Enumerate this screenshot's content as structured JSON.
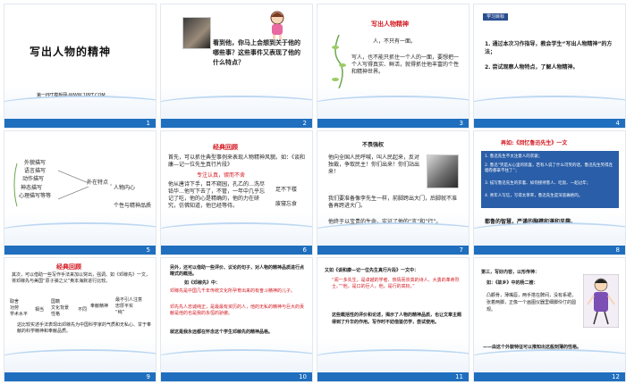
{
  "slides": [
    {
      "number": "1",
      "title": "写出人物的精神",
      "footer": "第一PPT模板网-WWW.1PPT.COM"
    },
    {
      "number": "2",
      "text": "看到他，你马上会想到关于他的哪些事？这些事件又表现了他的什么特点？"
    },
    {
      "number": "3",
      "heading": "写出人物精神",
      "line1": "人，不只有一面。",
      "body": "写人，也不能只抓住一个人的一面，要想把一个人写得真实、鲜活，就得抓住他丰富的个性和精神世界。"
    },
    {
      "number": "4",
      "tag": "学习目标",
      "goal1": "1. 通过本次习作指导，教会学生“写出人物精神”的方法；",
      "goal2": "2. 尝试观察人物特点，了解人物精神。"
    },
    {
      "number": "5",
      "items": [
        "外貌描写",
        "语言描写",
        "动作描写",
        "神态描写",
        "心理描写等等"
      ],
      "outer": "外在特点",
      "inner": "人物内心",
      "personality": "个性与精神品质"
    },
    {
      "number": "6",
      "heading": "经典回顾",
      "intro": "首先，可以抓住典型事例来表现人物精神风貌。如：《谈和康—记一位先生真行片段》",
      "red_label": "专注认真，锲而不舍",
      "body": "他从唐诗下手，目不窥园，孔乙的…洗尽铅华…他写下去了，不管，一年中几乎忘记了吃，他的心是精确的，他的力在研究，仿佛知道，他已经等待。",
      "side1": "足不下楼",
      "side2": "废寝忘食"
    },
    {
      "number": "7",
      "line1": "不畏强权",
      "body": "他向全国人民呼喊，叫人民起来，反对独裁，争取民主！你们出来！你们站出来！",
      "body2": "我们要准备像李先生一样，前脚跨出大门，后脚就不准备再跨进大门。",
      "body3": "他终于以宝贵的生命，实证了他的“言”和“行”。"
    },
    {
      "number": "8",
      "title": "再如:《回忆鲁迅先生》一文",
      "points": [
        "1. 鲁迅先生不太注意人的衣裳；",
        "2. 鲁迅“笑是从心里的欢喜，若有人说了什么可笑的话，鲁迅先生笑得连烟卷都拿不住了”；",
        "3. 描写鲁迅先生的衣着、如何接待客人、吃饭、一起过年；",
        "4. 青年人写信，写得太草率，鲁迅先生是深恶痛绝的。"
      ],
      "footer_line": "都鲁的智慧，严谨的胸襟和谦和风趣。"
    },
    {
      "number": "9",
      "heading": "经典回顾",
      "intro": "其次，可以借助一些写作手法来加以突出，强调。如《邓稼先》一文，将邓稼先与美国“原子弹之父”奥本海默进行比较。",
      "col1": [
        "取舍",
        "功劳",
        "学术水平"
      ],
      "col2": "相当",
      "col3": [
        "国籍",
        "文化背景",
        "性格"
      ],
      "col4": "不同",
      "col5": "奉献精神",
      "col6": [
        "最不引人注意",
        "忠厚平实",
        "“纯”"
      ],
      "body": "这比较实述手法表现出邓稼先为中国科学家的气质和无私心、甘于奉献的科学精神和奉献品质。"
    },
    {
      "number": "10",
      "text1": "另外，还可以借助一些评价、议论的句子，对人物的精神品质进行点睛式的概括。",
      "text2": "如《邓稼先》中：",
      "text3": "邓稼先是中国几千年传统文化所孕育出来的有奋斗精神的儿子。",
      "text4": "邓先先人忠诚纯正，是最最有资历的人，他的无私的精神与巨大的贡献是他的也是我的永恒的骄傲。",
      "text5": "就这是我永远都在怀念这个学生邓稼先的精神品格。"
    },
    {
      "number": "11",
      "text1": "又如《谈和康—记一位先生真行片段》一文中：",
      "quote": "“闻一多先生，是卓越的学者、热情而崇高的诗人、大勇的革命烈士。”“他，是口的巨人，他，是行的高标。”",
      "body": "这些概括性的评价和论述，揭示了人物的精神品质，也让文章主题得到了升华的作用。写作时不妨借鉴仿学，尝试使用。"
    },
    {
      "number": "12",
      "text1": "第三，写好内容，以形传神：",
      "text2": "如：《故乡》中的杨二嫂：",
      "text3": "凸颧骨，薄嘴唇，两手搭在髀间，没有系裙，张着两脚，正像一个画图仪器里细脚伶仃的圆规。",
      "text4": "——由这个外貌特征可以推知出这般刻薄的性格。"
    }
  ]
}
